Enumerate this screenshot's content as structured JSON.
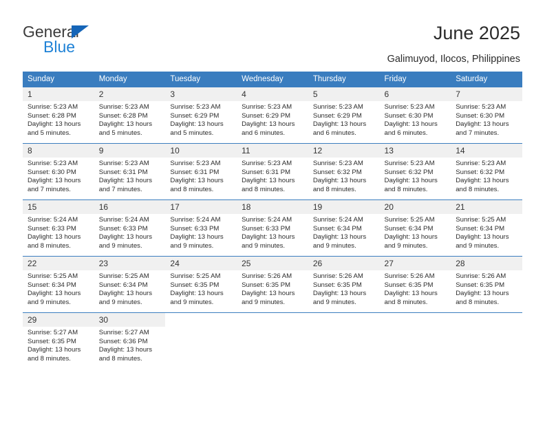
{
  "brand": {
    "name_part1": "General",
    "name_part2": "Blue",
    "logo_icon": "blue-triangle-flag"
  },
  "header": {
    "title": "June 2025",
    "location": "Galimuyod, Ilocos, Philippines"
  },
  "colors": {
    "header_blue": "#3a7dbf",
    "brand_blue": "#1f82d6",
    "daynum_bg": "#f0f0f0",
    "text": "#2b2b2b"
  },
  "weekday_headers": [
    "Sunday",
    "Monday",
    "Tuesday",
    "Wednesday",
    "Thursday",
    "Friday",
    "Saturday"
  ],
  "calendar_data": {
    "month": "June",
    "year": 2025,
    "location": "Galimuyod, Ilocos, Philippines",
    "first_day_column": "Sunday",
    "weeks": [
      [
        {
          "day": "1",
          "sunrise": "Sunrise: 5:23 AM",
          "sunset": "Sunset: 6:28 PM",
          "daylight_l1": "Daylight: 13 hours",
          "daylight_l2": "and 5 minutes."
        },
        {
          "day": "2",
          "sunrise": "Sunrise: 5:23 AM",
          "sunset": "Sunset: 6:28 PM",
          "daylight_l1": "Daylight: 13 hours",
          "daylight_l2": "and 5 minutes."
        },
        {
          "day": "3",
          "sunrise": "Sunrise: 5:23 AM",
          "sunset": "Sunset: 6:29 PM",
          "daylight_l1": "Daylight: 13 hours",
          "daylight_l2": "and 5 minutes."
        },
        {
          "day": "4",
          "sunrise": "Sunrise: 5:23 AM",
          "sunset": "Sunset: 6:29 PM",
          "daylight_l1": "Daylight: 13 hours",
          "daylight_l2": "and 6 minutes."
        },
        {
          "day": "5",
          "sunrise": "Sunrise: 5:23 AM",
          "sunset": "Sunset: 6:29 PM",
          "daylight_l1": "Daylight: 13 hours",
          "daylight_l2": "and 6 minutes."
        },
        {
          "day": "6",
          "sunrise": "Sunrise: 5:23 AM",
          "sunset": "Sunset: 6:30 PM",
          "daylight_l1": "Daylight: 13 hours",
          "daylight_l2": "and 6 minutes."
        },
        {
          "day": "7",
          "sunrise": "Sunrise: 5:23 AM",
          "sunset": "Sunset: 6:30 PM",
          "daylight_l1": "Daylight: 13 hours",
          "daylight_l2": "and 7 minutes."
        }
      ],
      [
        {
          "day": "8",
          "sunrise": "Sunrise: 5:23 AM",
          "sunset": "Sunset: 6:30 PM",
          "daylight_l1": "Daylight: 13 hours",
          "daylight_l2": "and 7 minutes."
        },
        {
          "day": "9",
          "sunrise": "Sunrise: 5:23 AM",
          "sunset": "Sunset: 6:31 PM",
          "daylight_l1": "Daylight: 13 hours",
          "daylight_l2": "and 7 minutes."
        },
        {
          "day": "10",
          "sunrise": "Sunrise: 5:23 AM",
          "sunset": "Sunset: 6:31 PM",
          "daylight_l1": "Daylight: 13 hours",
          "daylight_l2": "and 8 minutes."
        },
        {
          "day": "11",
          "sunrise": "Sunrise: 5:23 AM",
          "sunset": "Sunset: 6:31 PM",
          "daylight_l1": "Daylight: 13 hours",
          "daylight_l2": "and 8 minutes."
        },
        {
          "day": "12",
          "sunrise": "Sunrise: 5:23 AM",
          "sunset": "Sunset: 6:32 PM",
          "daylight_l1": "Daylight: 13 hours",
          "daylight_l2": "and 8 minutes."
        },
        {
          "day": "13",
          "sunrise": "Sunrise: 5:23 AM",
          "sunset": "Sunset: 6:32 PM",
          "daylight_l1": "Daylight: 13 hours",
          "daylight_l2": "and 8 minutes."
        },
        {
          "day": "14",
          "sunrise": "Sunrise: 5:23 AM",
          "sunset": "Sunset: 6:32 PM",
          "daylight_l1": "Daylight: 13 hours",
          "daylight_l2": "and 8 minutes."
        }
      ],
      [
        {
          "day": "15",
          "sunrise": "Sunrise: 5:24 AM",
          "sunset": "Sunset: 6:33 PM",
          "daylight_l1": "Daylight: 13 hours",
          "daylight_l2": "and 8 minutes."
        },
        {
          "day": "16",
          "sunrise": "Sunrise: 5:24 AM",
          "sunset": "Sunset: 6:33 PM",
          "daylight_l1": "Daylight: 13 hours",
          "daylight_l2": "and 9 minutes."
        },
        {
          "day": "17",
          "sunrise": "Sunrise: 5:24 AM",
          "sunset": "Sunset: 6:33 PM",
          "daylight_l1": "Daylight: 13 hours",
          "daylight_l2": "and 9 minutes."
        },
        {
          "day": "18",
          "sunrise": "Sunrise: 5:24 AM",
          "sunset": "Sunset: 6:33 PM",
          "daylight_l1": "Daylight: 13 hours",
          "daylight_l2": "and 9 minutes."
        },
        {
          "day": "19",
          "sunrise": "Sunrise: 5:24 AM",
          "sunset": "Sunset: 6:34 PM",
          "daylight_l1": "Daylight: 13 hours",
          "daylight_l2": "and 9 minutes."
        },
        {
          "day": "20",
          "sunrise": "Sunrise: 5:25 AM",
          "sunset": "Sunset: 6:34 PM",
          "daylight_l1": "Daylight: 13 hours",
          "daylight_l2": "and 9 minutes."
        },
        {
          "day": "21",
          "sunrise": "Sunrise: 5:25 AM",
          "sunset": "Sunset: 6:34 PM",
          "daylight_l1": "Daylight: 13 hours",
          "daylight_l2": "and 9 minutes."
        }
      ],
      [
        {
          "day": "22",
          "sunrise": "Sunrise: 5:25 AM",
          "sunset": "Sunset: 6:34 PM",
          "daylight_l1": "Daylight: 13 hours",
          "daylight_l2": "and 9 minutes."
        },
        {
          "day": "23",
          "sunrise": "Sunrise: 5:25 AM",
          "sunset": "Sunset: 6:34 PM",
          "daylight_l1": "Daylight: 13 hours",
          "daylight_l2": "and 9 minutes."
        },
        {
          "day": "24",
          "sunrise": "Sunrise: 5:25 AM",
          "sunset": "Sunset: 6:35 PM",
          "daylight_l1": "Daylight: 13 hours",
          "daylight_l2": "and 9 minutes."
        },
        {
          "day": "25",
          "sunrise": "Sunrise: 5:26 AM",
          "sunset": "Sunset: 6:35 PM",
          "daylight_l1": "Daylight: 13 hours",
          "daylight_l2": "and 9 minutes."
        },
        {
          "day": "26",
          "sunrise": "Sunrise: 5:26 AM",
          "sunset": "Sunset: 6:35 PM",
          "daylight_l1": "Daylight: 13 hours",
          "daylight_l2": "and 9 minutes."
        },
        {
          "day": "27",
          "sunrise": "Sunrise: 5:26 AM",
          "sunset": "Sunset: 6:35 PM",
          "daylight_l1": "Daylight: 13 hours",
          "daylight_l2": "and 8 minutes."
        },
        {
          "day": "28",
          "sunrise": "Sunrise: 5:26 AM",
          "sunset": "Sunset: 6:35 PM",
          "daylight_l1": "Daylight: 13 hours",
          "daylight_l2": "and 8 minutes."
        }
      ],
      [
        {
          "day": "29",
          "sunrise": "Sunrise: 5:27 AM",
          "sunset": "Sunset: 6:35 PM",
          "daylight_l1": "Daylight: 13 hours",
          "daylight_l2": "and 8 minutes."
        },
        {
          "day": "30",
          "sunrise": "Sunrise: 5:27 AM",
          "sunset": "Sunset: 6:36 PM",
          "daylight_l1": "Daylight: 13 hours",
          "daylight_l2": "and 8 minutes."
        },
        {
          "day": "",
          "sunrise": "",
          "sunset": "",
          "daylight_l1": "",
          "daylight_l2": ""
        },
        {
          "day": "",
          "sunrise": "",
          "sunset": "",
          "daylight_l1": "",
          "daylight_l2": ""
        },
        {
          "day": "",
          "sunrise": "",
          "sunset": "",
          "daylight_l1": "",
          "daylight_l2": ""
        },
        {
          "day": "",
          "sunrise": "",
          "sunset": "",
          "daylight_l1": "",
          "daylight_l2": ""
        },
        {
          "day": "",
          "sunrise": "",
          "sunset": "",
          "daylight_l1": "",
          "daylight_l2": ""
        }
      ]
    ]
  }
}
